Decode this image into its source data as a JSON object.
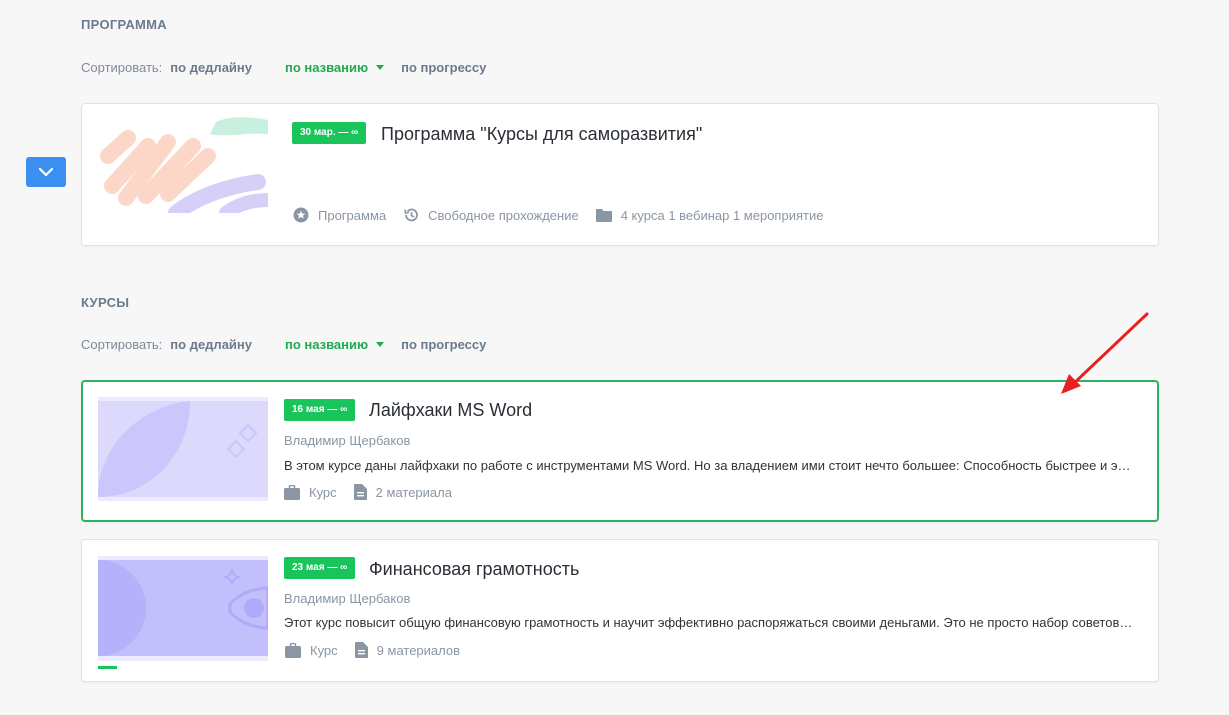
{
  "program_section": {
    "title": "ПРОГРАММА",
    "sort": {
      "label": "Сортировать:",
      "by_deadline": "по дедлайну",
      "by_name": "по названию",
      "by_progress": "по прогрессу"
    },
    "card": {
      "badge": "30 мар. — ∞",
      "title": "Программа \"Курсы для саморазвития\"",
      "meta": {
        "type": "Программа",
        "mode": "Свободное прохождение",
        "contents": "4 курса 1 вебинар 1 мероприятие"
      }
    }
  },
  "courses_section": {
    "title": "КУРСЫ",
    "sort": {
      "label": "Сортировать:",
      "by_deadline": "по дедлайну",
      "by_name": "по названию",
      "by_progress": "по прогрессу"
    },
    "items": [
      {
        "badge": "16 мая — ∞",
        "title": "Лайфхаки MS Word",
        "author": "Владимир Щербаков",
        "description": "В этом курсе даны лайфхаки по работе с инструментами MS Word. Но за владением ими стоит нечто большее: Способность быстрее и эффективнее решать задачи",
        "type": "Курс",
        "materials": "2 материала",
        "progress": 0
      },
      {
        "badge": "23 мая — ∞",
        "title": "Финансовая грамотность",
        "author": "Владимир Щербаков",
        "description": "Этот курс повысит общую финансовую грамотность и научит эффективно распоряжаться своими деньгами. Это не просто набор советов и рекомендаций",
        "type": "Курс",
        "materials": "9 материалов",
        "progress": 0.11
      }
    ]
  },
  "colors": {
    "accent_green": "#19c55a",
    "button_blue": "#3a8ff0",
    "annotation_red": "#e8201f"
  }
}
